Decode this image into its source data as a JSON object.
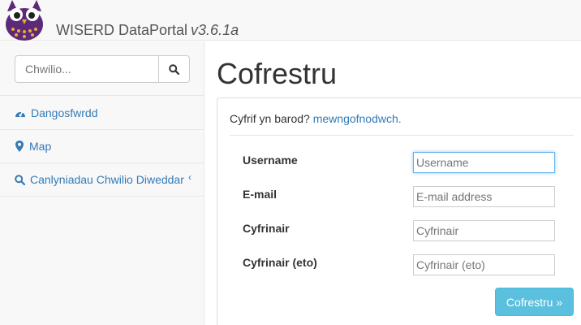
{
  "header": {
    "brand": "WISERD DataPortal",
    "version": "v3.6.1a",
    "logo_icon": "owl-logo-icon"
  },
  "sidebar": {
    "search_placeholder": "Chwilio...",
    "search_icon": "search-icon",
    "items": [
      {
        "label": "Dangosfwrdd",
        "icon": "dashboard-icon"
      },
      {
        "label": "Map",
        "icon": "map-marker-icon"
      },
      {
        "label": "Canlyniadau Chwilio Diweddar",
        "icon": "search-icon",
        "caret": "‹"
      }
    ]
  },
  "main": {
    "title": "Cofrestru",
    "prompt_text": "Cyfrif yn barod?",
    "login_link": "mewngofnodwch.",
    "fields": [
      {
        "label": "Username",
        "placeholder": "Username"
      },
      {
        "label": "E-mail",
        "placeholder": "E-mail address"
      },
      {
        "label": "Cyfrinair",
        "placeholder": "Cyfrinair"
      },
      {
        "label": "Cyfrinair (eto)",
        "placeholder": "Cyfrinair (eto)"
      }
    ],
    "submit_label": "Cofrestru »"
  },
  "colors": {
    "link": "#337ab7",
    "button": "#5bc0de",
    "logo": "#5b2b7a"
  }
}
